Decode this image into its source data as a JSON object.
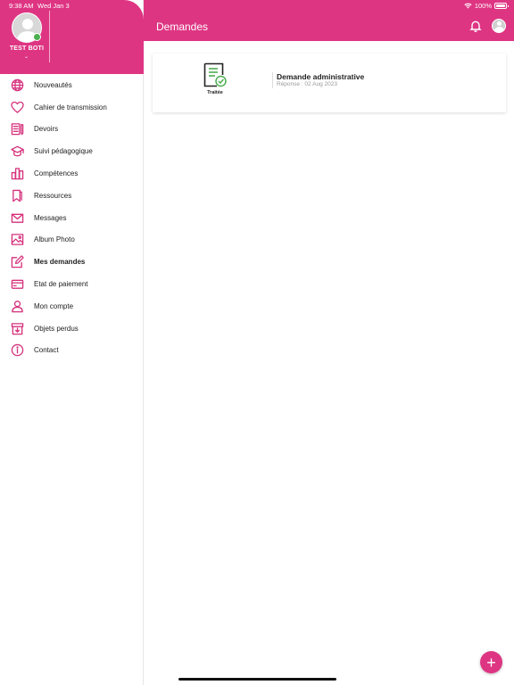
{
  "status_bar": {
    "time": "9:38 AM",
    "date": "Wed Jan 3",
    "battery": "100%"
  },
  "profile": {
    "name": "TEST BOTI",
    "status_color": "#4caf50"
  },
  "header": {
    "title": "Demandes"
  },
  "menu": [
    {
      "label": "Nouveautés",
      "icon": "globe-icon"
    },
    {
      "label": "Cahier de transmission",
      "icon": "heart-icon"
    },
    {
      "label": "Devoirs",
      "icon": "homework-icon"
    },
    {
      "label": "Suivi pédagogique",
      "icon": "graduation-cap-icon"
    },
    {
      "label": "Compétences",
      "icon": "bar-chart-icon"
    },
    {
      "label": "Ressources",
      "icon": "bookmark-icon"
    },
    {
      "label": "Messages",
      "icon": "envelope-icon"
    },
    {
      "label": "Album Photo",
      "icon": "photo-icon"
    },
    {
      "label": "Mes demandes",
      "icon": "edit-icon",
      "active": true
    },
    {
      "label": "Etat de paiement",
      "icon": "credit-card-icon"
    },
    {
      "label": "Mon compte",
      "icon": "user-icon"
    },
    {
      "label": "Objets perdus",
      "icon": "box-icon"
    },
    {
      "label": "Contact",
      "icon": "info-icon"
    }
  ],
  "requests": [
    {
      "status": "Traitée",
      "title": "Demande administrative",
      "subtitle": "Réponse : 02 Aug 2023",
      "status_icon": "document-check-icon"
    }
  ],
  "fab": {
    "label": "+",
    "icon": "plus-icon"
  },
  "colors": {
    "accent": "#de3583",
    "icon": "#d6317c",
    "success": "#4caf50"
  }
}
